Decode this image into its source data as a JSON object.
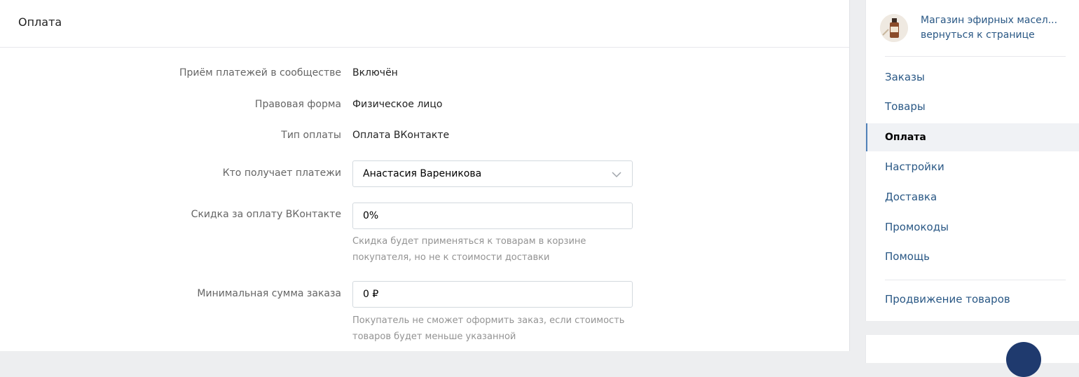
{
  "page": {
    "title": "Оплата"
  },
  "settings": {
    "payments_enabled": {
      "label": "Приём платежей в сообществе",
      "value": "Включён"
    },
    "legal_form": {
      "label": "Правовая форма",
      "value": "Физическое лицо"
    },
    "payment_type": {
      "label": "Тип оплаты",
      "value": "Оплата ВКонтакте"
    },
    "recipient": {
      "label": "Кто получает платежи",
      "value": "Анастасия Вареникова"
    },
    "discount": {
      "label": "Скидка за оплату ВКонтакте",
      "value": "0%",
      "hint": "Скидка будет применяться к товарам в корзине покупателя, но не к стоимости доставки"
    },
    "min_order": {
      "label": "Минимальная сумма заказа",
      "value": "0 ₽",
      "hint": "Покупатель не сможет оформить заказ, если стоимость товаров будет меньше указанной"
    }
  },
  "sidebar": {
    "shop_name": "Магазин эфирных масел...",
    "back_link": "вернуться к странице",
    "items": [
      {
        "label": "Заказы",
        "active": false
      },
      {
        "label": "Товары",
        "active": false
      },
      {
        "label": "Оплата",
        "active": true
      },
      {
        "label": "Настройки",
        "active": false
      },
      {
        "label": "Доставка",
        "active": false
      },
      {
        "label": "Промокоды",
        "active": false
      },
      {
        "label": "Помощь",
        "active": false
      }
    ],
    "promo_item": "Продвижение товаров"
  },
  "colors": {
    "link": "#2a5885",
    "active_bar": "#5181b8",
    "muted": "#939393"
  }
}
